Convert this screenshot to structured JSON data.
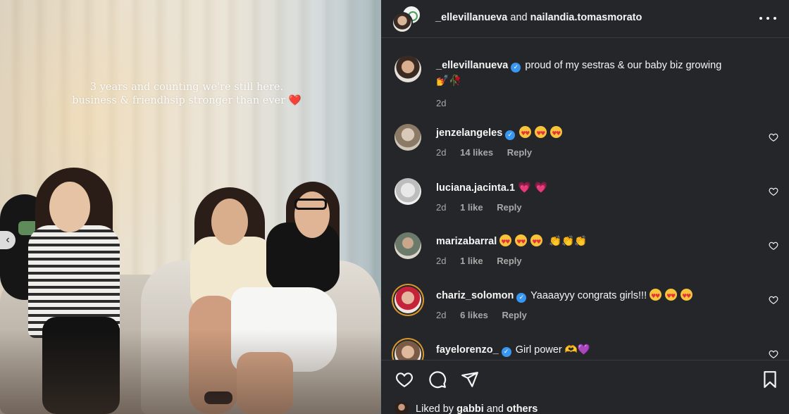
{
  "photo": {
    "overlay_line1": "3 years and counting we're still here.",
    "overlay_line2": "business & friendhsip stronger than ever",
    "overlay_emoji": "❤️",
    "prev_icon": "‹"
  },
  "header": {
    "user1": "_ellevillanueva",
    "connector": "and",
    "user2": "nailandia.tomasmorato"
  },
  "caption": {
    "username": "_ellevillanueva",
    "verified": true,
    "text": "proud of my sestras & our baby biz growing",
    "emojis": "💅🥀",
    "time": "2d"
  },
  "comments": [
    {
      "username": "jenzelangeles",
      "verified": true,
      "text": "",
      "emoji_faces": 3,
      "time": "2d",
      "likes": "14 likes",
      "reply": "Reply"
    },
    {
      "username": "luciana.jacinta.1",
      "verified": false,
      "text": "",
      "hearts": "💗 💗",
      "time": "2d",
      "likes": "1 like",
      "reply": "Reply"
    },
    {
      "username": "marizabarral",
      "verified": false,
      "text": "",
      "emoji_faces": 3,
      "claps": "👏👏👏",
      "time": "2d",
      "likes": "1 like",
      "reply": "Reply"
    },
    {
      "username": "chariz_solomon",
      "verified": true,
      "text": "Yaaaayyy congrats girls!!!",
      "emoji_faces": 3,
      "time": "2d",
      "likes": "6 likes",
      "reply": "Reply"
    },
    {
      "username": "fayelorenzo_",
      "verified": true,
      "text": "Girl power",
      "tail_emojis": "🫶💜"
    }
  ],
  "footer": {
    "liked_by_prefix": "Liked by",
    "liked_by_user": "gabbi",
    "liked_by_connector": "and",
    "liked_by_others": "others"
  },
  "icons": {
    "verified_glyph": "✓",
    "heart": "heart-icon",
    "comment": "comment-icon",
    "share": "share-icon",
    "save": "bookmark-icon"
  },
  "colors": {
    "pane_bg": "#25262a",
    "verified": "#3897f0",
    "meta_text": "#a8a8a8"
  }
}
